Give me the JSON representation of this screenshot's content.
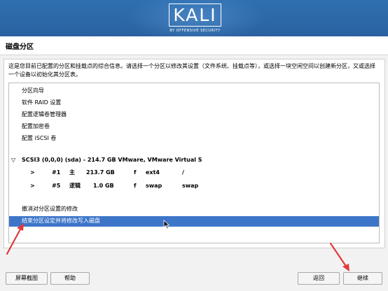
{
  "brand": {
    "logo_text": "KALI",
    "logo_subtitle": "BY OFFENSIVE SECURITY",
    "banner_color": "#2f6fb0"
  },
  "page": {
    "title": "磁盘分区",
    "description": "这是您目前已配置的分区和挂载点的综合信息。请选择一个分区以修改其设置（文件系统、挂载点等），或选择一块空闲空间以创建新分区，又或选择一个设备以初始化其分区表。"
  },
  "menu": {
    "guided": "分区向导",
    "raid": "软件 RAID 设置",
    "lvm": "配置逻辑卷管理器",
    "encrypted": "配置加密卷",
    "iscsi": "配置 iSCSI 卷"
  },
  "disk": {
    "toggle": "▽",
    "label": "SCSI3 (0,0,0) (sda) - 214.7 GB VMware, VMware Virtual S",
    "partitions": [
      {
        "arrow": ">",
        "num": "#1",
        "type": "主",
        "size": "213.7 GB",
        "flag": "f",
        "fs": "ext4",
        "mount": "/"
      },
      {
        "arrow": ">",
        "num": "#5",
        "type": "逻辑",
        "size": "1.0 GB",
        "flag": "f",
        "fs": "swap",
        "mount": "swap"
      }
    ]
  },
  "actions": {
    "undo": "撤消对分区设置的修改",
    "finish": "结束分区设定并将修改写入磁盘"
  },
  "buttons": {
    "screenshot": "屏幕截图",
    "help": "帮助",
    "back": "返回",
    "continue": "继续"
  },
  "colors": {
    "selection": "#3d76c9",
    "annotation_arrow": "#e03a3a"
  }
}
